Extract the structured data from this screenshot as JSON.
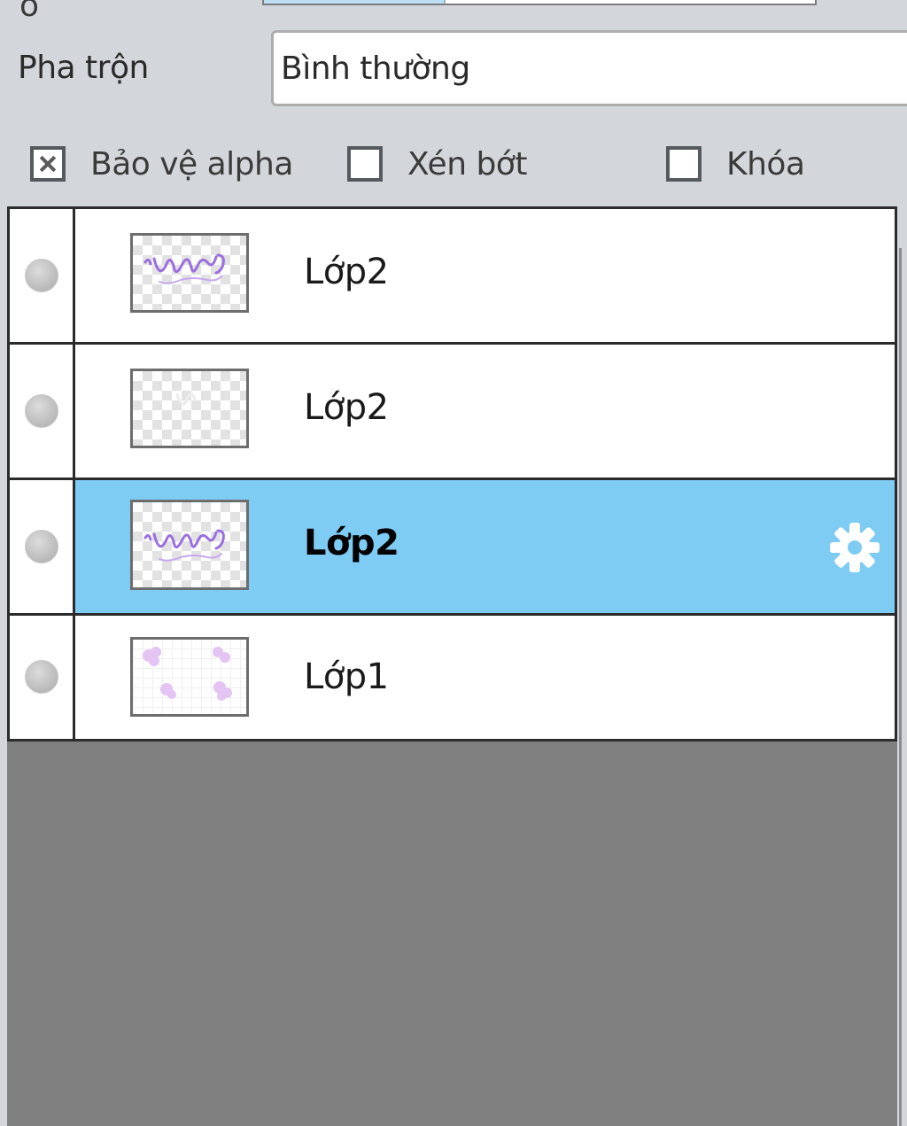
{
  "top_row": {
    "label_fragment": "ồ",
    "opacity_fill_fraction": 0.33
  },
  "blend": {
    "label": "Pha trộn",
    "value": "Bình thường"
  },
  "options": {
    "alpha_protect": {
      "label": "Bảo vệ alpha",
      "checked": true
    },
    "clip": {
      "label": "Xén bớt",
      "checked": false
    },
    "lock": {
      "label": "Khóa",
      "checked": false
    }
  },
  "layers": [
    {
      "name": "Lớp2",
      "selected": false,
      "thumbnail": "purple-script"
    },
    {
      "name": "Lớp2",
      "selected": false,
      "thumbnail": "faint-script"
    },
    {
      "name": "Lớp2",
      "selected": true,
      "thumbnail": "purple-script"
    },
    {
      "name": "Lớp1",
      "selected": false,
      "thumbnail": "pink-flowers"
    }
  ],
  "colors": {
    "panel_bg": "#d3d7db",
    "selected_row": "#7ecbf4",
    "empty_area": "#808080",
    "thumbnail_ink": "#9b6fe0"
  },
  "icons": {
    "settings": "gear-icon",
    "visibility": "visibility-dot-icon"
  }
}
